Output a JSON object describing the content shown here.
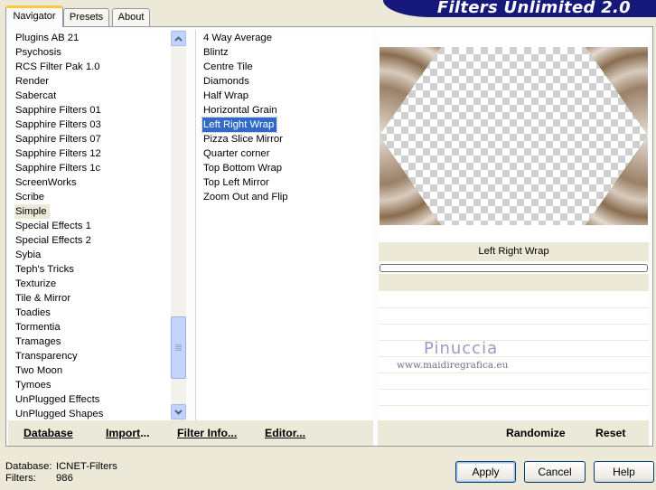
{
  "window": {
    "banner_title": "Filters Unlimited 2.0"
  },
  "tabs": [
    {
      "label": "Navigator",
      "active": true
    },
    {
      "label": "Presets",
      "active": false
    },
    {
      "label": "About",
      "active": false
    }
  ],
  "categories": {
    "items": [
      "Plugins AB 21",
      "Psychosis",
      "RCS Filter Pak 1.0",
      "Render",
      "Sabercat",
      "Sapphire Filters 01",
      "Sapphire Filters 03",
      "Sapphire Filters 07",
      "Sapphire Filters 12",
      "Sapphire Filters 1c",
      "ScreenWorks",
      "Scribe",
      "Simple",
      "Special Effects 1",
      "Special Effects 2",
      "Sybia",
      "Teph's Tricks",
      "Texturize",
      "Tile & Mirror",
      "Toadies",
      "Tormentia",
      "Tramages",
      "Transparency",
      "Two Moon",
      "Tymoes",
      "UnPlugged Effects",
      "UnPlugged Shapes"
    ],
    "highlighted": "Simple"
  },
  "filters": {
    "items": [
      "4 Way Average",
      "Blintz",
      "Centre Tile",
      "Diamonds",
      "Half Wrap",
      "Horizontal Grain",
      "Left Right Wrap",
      "Pizza Slice Mirror",
      "Quarter corner",
      "Top Bottom Wrap",
      "Top Left Mirror",
      "Zoom Out and Flip"
    ],
    "selected": "Left Right Wrap"
  },
  "preview": {
    "filter_name": "Left Right Wrap",
    "watermark_name": "Pinuccia",
    "watermark_url": "www.maidiregrafica.eu"
  },
  "link_buttons": {
    "database": {
      "label": "Database"
    },
    "import": {
      "prefix": "Import",
      "suffix": "..."
    },
    "filter_info": {
      "label": "Filter Info..."
    },
    "editor": {
      "label": "Editor..."
    },
    "randomize": {
      "label": "Randomize"
    },
    "reset": {
      "label": "Reset"
    }
  },
  "footer": {
    "database_label": "Database:",
    "database_value": "ICNET-Filters",
    "filters_label": "Filters:",
    "filters_value": "986"
  },
  "buttons": {
    "apply": "Apply",
    "cancel": "Cancel",
    "help": "Help"
  },
  "colors": {
    "selection": "#316ac5",
    "banner": "#17197a",
    "tab_highlight": "#ffc83c"
  },
  "icons": [
    "scroll-up-arrow-icon",
    "scroll-down-arrow-icon",
    "scroll-grip-icon"
  ]
}
